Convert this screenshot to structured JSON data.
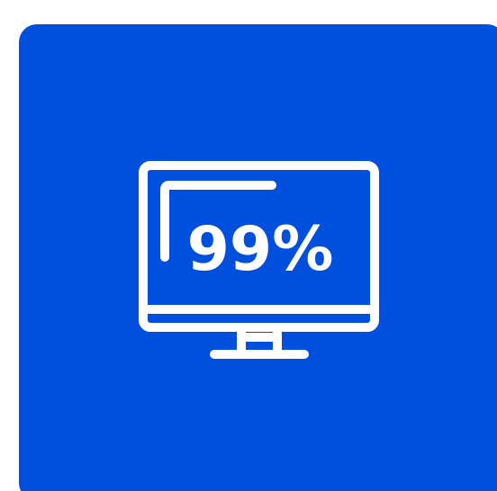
{
  "tile": {
    "background_color": "#0050dd",
    "icon": "monitor-icon",
    "icon_color": "#ffffff"
  },
  "screen": {
    "percent_text": "99%"
  }
}
